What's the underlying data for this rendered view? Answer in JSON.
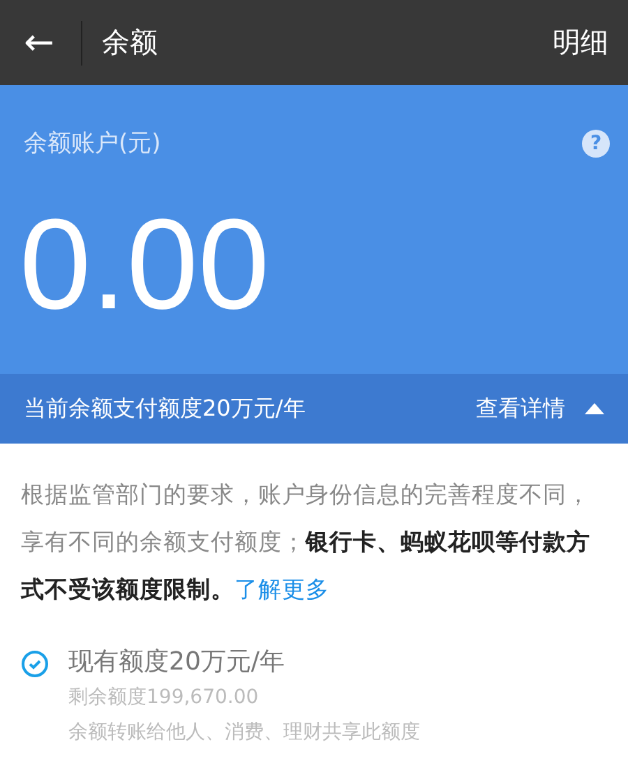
{
  "header": {
    "back": "←",
    "title": "余额",
    "action": "明细"
  },
  "balance": {
    "label": "余额账户(元)",
    "help": "?",
    "amount": "0.00"
  },
  "limit_bar": {
    "text": "当前余额支付额度20万元/年",
    "link": "查看详情",
    "expanded": true
  },
  "notice": {
    "text": "根据监管部门的要求，账户身份信息的完善程度不同，享有不同的余额支付额度；**银行卡、蚂蚁花呗等付款方式不受该额度限制。**",
    "link": "了解更多"
  },
  "quotas": [
    {
      "title": "现有额度20万元/年",
      "checked": true,
      "lines": [
        "剩余额度199,670.00",
        "余额转账给他人、消费、理财共享此额度"
      ]
    }
  ]
}
